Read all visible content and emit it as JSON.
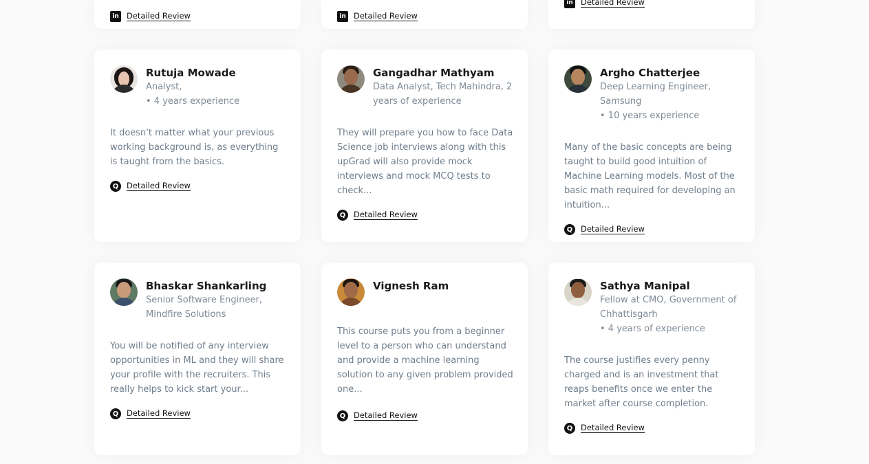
{
  "top_row": [
    {
      "icon": "linkedin-icon",
      "review_label": "Detailed Review"
    },
    {
      "icon": "linkedin-icon",
      "review_label": "Detailed Review"
    },
    {
      "icon": "linkedin-icon",
      "review_label": "Detailed Review"
    }
  ],
  "reviews": [
    {
      "name": "Rutuja Mowade",
      "role_lines": [
        "Analyst,",
        "• 4 years experience"
      ],
      "quote": "It doesn't matter what your previous working background is, as everything is taught from the basics.",
      "icon": "quora-icon",
      "review_label": "Detailed Review"
    },
    {
      "name": "Gangadhar Mathyam",
      "role_lines": [
        "Data Analyst, Tech Mahindra, 2",
        "years of experience"
      ],
      "quote": "They will prepare you how to face Data Science job interviews along with this upGrad will also provide mock interviews and mock MCQ tests to check...",
      "icon": "quora-icon",
      "review_label": "Detailed Review"
    },
    {
      "name": "Argho Chatterjee",
      "role_lines": [
        "Deep Learning Engineer,",
        "Samsung",
        "• 10 years experience"
      ],
      "quote": "Many of the basic concepts are being taught to build good intuition of Machine Learning models. Most of the basic math required for developing an intuition...",
      "icon": "quora-icon",
      "review_label": "Detailed Review"
    },
    {
      "name": "Bhaskar Shankarling",
      "role_lines": [
        "Senior Software Engineer,",
        "Mindfire Solutions"
      ],
      "quote": "You will be notified of any interview opportunities in ML and they will share your profile with the recruiters. This really helps to kick start your...",
      "icon": "quora-icon",
      "review_label": "Detailed Review"
    },
    {
      "name": "Vignesh Ram",
      "role_lines": [],
      "quote": "This course puts you from a beginner level to a person who can understand and provide a machine learning solution to any given problem provided one...",
      "icon": "quora-icon",
      "review_label": "Detailed Review"
    },
    {
      "name": "Sathya Manipal",
      "role_lines": [
        "Fellow at CMO, Government of",
        "Chhattisgarh",
        "• 4 years of experience"
      ],
      "quote": "The course justifies every penny charged and is an investment that reaps benefits once we enter the market after course completion.",
      "icon": "quora-icon",
      "review_label": "Detailed Review"
    }
  ],
  "colors": {
    "name": "#1b1b1b",
    "role": "#7e8a96",
    "quote": "#6f7e8c",
    "background": "#fafafa",
    "card": "#ffffff"
  }
}
